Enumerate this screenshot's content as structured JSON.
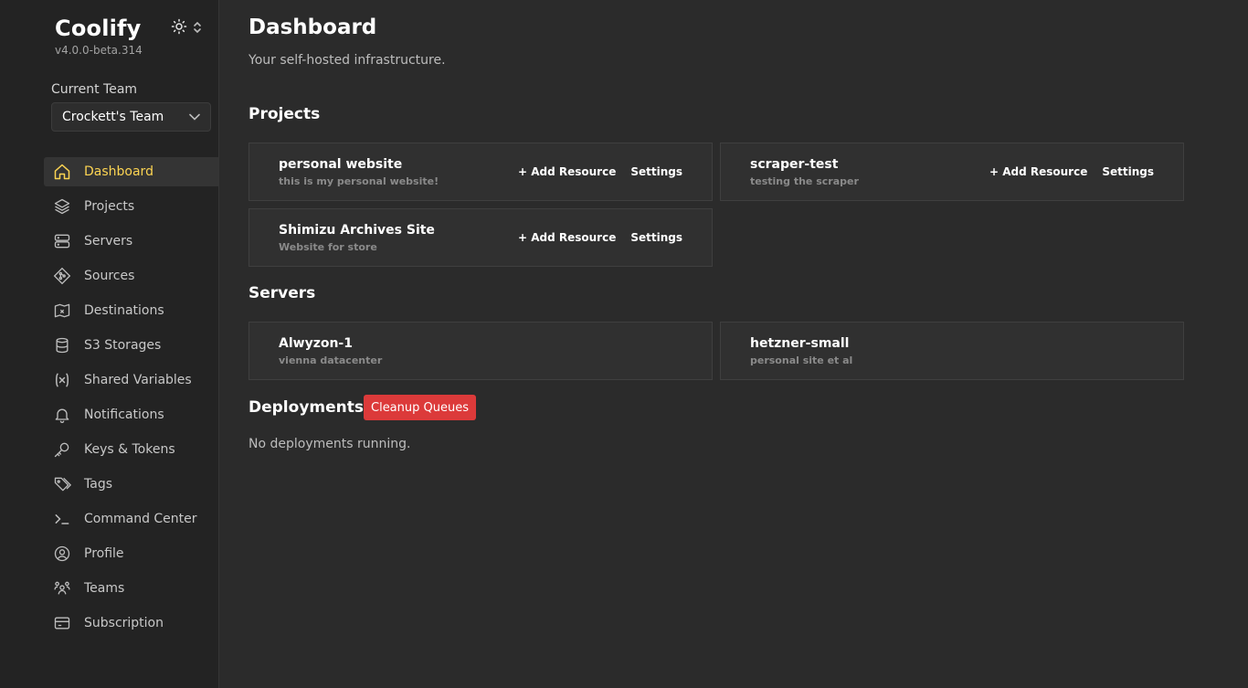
{
  "app": {
    "name": "Coolify",
    "version": "v4.0.0-beta.314",
    "theme_toggle_icon": "sun-icon"
  },
  "team": {
    "label": "Current Team",
    "selected": "Crockett's Team"
  },
  "nav": [
    {
      "label": "Dashboard",
      "icon": "home-icon",
      "active": true
    },
    {
      "label": "Projects",
      "icon": "layers-icon"
    },
    {
      "label": "Servers",
      "icon": "server-icon"
    },
    {
      "label": "Sources",
      "icon": "git-icon"
    },
    {
      "label": "Destinations",
      "icon": "map-icon"
    },
    {
      "label": "S3 Storages",
      "icon": "database-icon"
    },
    {
      "label": "Shared Variables",
      "icon": "variable-icon"
    },
    {
      "label": "Notifications",
      "icon": "bell-icon"
    },
    {
      "label": "Keys & Tokens",
      "icon": "key-icon"
    },
    {
      "label": "Tags",
      "icon": "tag-icon"
    },
    {
      "label": "Command Center",
      "icon": "terminal-icon"
    },
    {
      "label": "Profile",
      "icon": "user-circle-icon"
    },
    {
      "label": "Teams",
      "icon": "users-icon"
    },
    {
      "label": "Subscription",
      "icon": "credit-card-icon"
    }
  ],
  "page": {
    "title": "Dashboard",
    "subtitle": "Your self-hosted infrastructure."
  },
  "projects": {
    "heading": "Projects",
    "add_resource_label": "+ Add Resource",
    "settings_label": "Settings",
    "items": [
      {
        "name": "personal website",
        "description": "this is my personal website!"
      },
      {
        "name": "scraper-test",
        "description": "testing the scraper"
      },
      {
        "name": "Shimizu Archives Site",
        "description": "Website for store"
      }
    ]
  },
  "servers": {
    "heading": "Servers",
    "items": [
      {
        "name": "Alwyzon-1",
        "description": "vienna datacenter"
      },
      {
        "name": "hetzner-small",
        "description": "personal site et al"
      }
    ]
  },
  "deployments": {
    "heading": "Deployments",
    "cleanup_label": "Cleanup Queues",
    "empty_text": "No deployments running."
  },
  "colors": {
    "accent": "#fcd452",
    "danger": "#dc3a3a",
    "background": "#2b2b2b",
    "sidebar": "#232323"
  }
}
